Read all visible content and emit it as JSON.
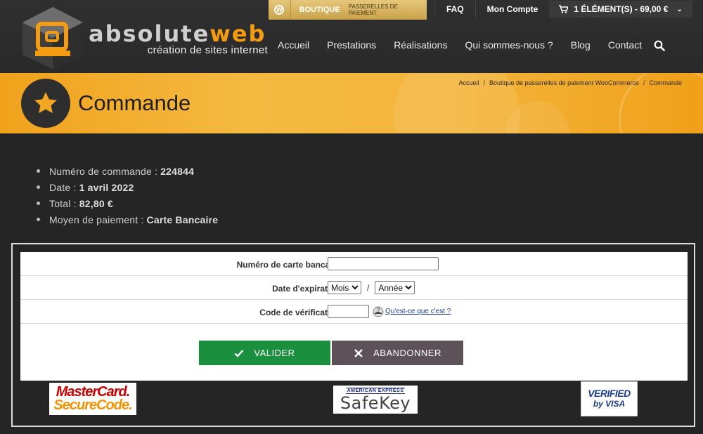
{
  "header": {
    "logo": {
      "word1": "absolute",
      "word2": "web",
      "tagline": "création de sites internet"
    },
    "boutique": {
      "label": "BOUTIQUE",
      "sublabel": "PASSERELLES DE PAIEMENT"
    },
    "topnav": {
      "faq": "FAQ",
      "account": "Mon Compte",
      "cart": "1 ÉLÉMENT(S) - 69,00 €"
    },
    "mainnav": [
      "Accueil",
      "Prestations",
      "Réalisations",
      "Qui sommes-nous ?",
      "Blog",
      "Contact"
    ]
  },
  "title_band": {
    "title": "Commande",
    "breadcrumb": [
      "Accueil",
      "Boutique de passerelles de paiement WooCommerce",
      "Commande"
    ]
  },
  "order_summary": [
    {
      "label": "Numéro de commande :",
      "value": "224844"
    },
    {
      "label": "Date :",
      "value": "1 avril 2022"
    },
    {
      "label": "Total :",
      "value": "82,80 €"
    },
    {
      "label": "Moyen de paiement :",
      "value": "Carte Bancaire"
    }
  ],
  "payment_form": {
    "card_number": {
      "label": "Numéro de carte bancaire",
      "value": ""
    },
    "expiry": {
      "label": "Date d'expiration",
      "month_selected": "Mois",
      "year_selected": "Année",
      "separator": "/"
    },
    "cvv": {
      "label": "Code de vérification",
      "value": "",
      "help_link": "Qu'est-ce que c'est ?"
    },
    "buttons": {
      "submit": "VALIDER",
      "cancel": "ABANDONNER"
    },
    "colors": {
      "submit": "#1a8f3d",
      "cancel": "#5d5258"
    }
  },
  "security_logos": {
    "mastercard": {
      "line1": "MasterCard.",
      "line2": "SecureCode."
    },
    "amex": {
      "line1": "AMERICAN EXPRESS",
      "line2": "SafeKey"
    },
    "visa": {
      "line1": "VERIFIED",
      "line2": "by VISA"
    }
  },
  "colors": {
    "accent": "#f39c12",
    "header_bg": "#2f2f2f",
    "page_bg": "#252525"
  }
}
